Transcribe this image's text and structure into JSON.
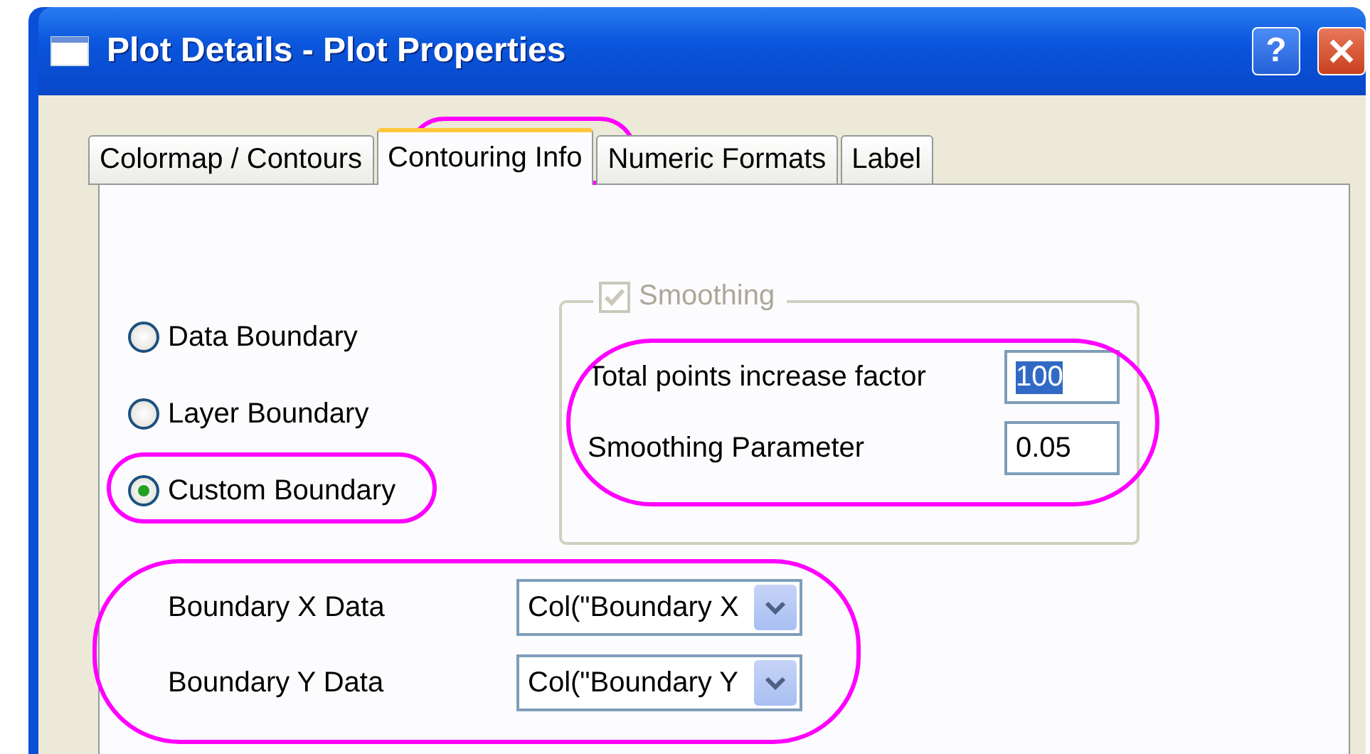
{
  "window": {
    "title": "Plot Details - Plot Properties",
    "help_button": "?"
  },
  "tabs": [
    {
      "label": "Colormap / Contours",
      "selected": false
    },
    {
      "label": "Contouring Info",
      "selected": true
    },
    {
      "label": "Numeric Formats",
      "selected": false
    },
    {
      "label": "Label",
      "selected": false
    }
  ],
  "boundary_options": [
    {
      "label": "Data Boundary",
      "selected": false
    },
    {
      "label": "Layer Boundary",
      "selected": false
    },
    {
      "label": "Custom Boundary",
      "selected": true
    }
  ],
  "smoothing": {
    "label": "Smoothing",
    "checked": true,
    "disabled": true,
    "fields": [
      {
        "label": "Total points increase factor",
        "value": "100",
        "highlighted": true
      },
      {
        "label": "Smoothing Parameter",
        "value": "0.05",
        "highlighted": false
      }
    ]
  },
  "data_columns": [
    {
      "label": "Boundary X Data",
      "value": "Col(\"Boundary X"
    },
    {
      "label": "Boundary Y Data",
      "value": "Col(\"Boundary Y"
    }
  ]
}
